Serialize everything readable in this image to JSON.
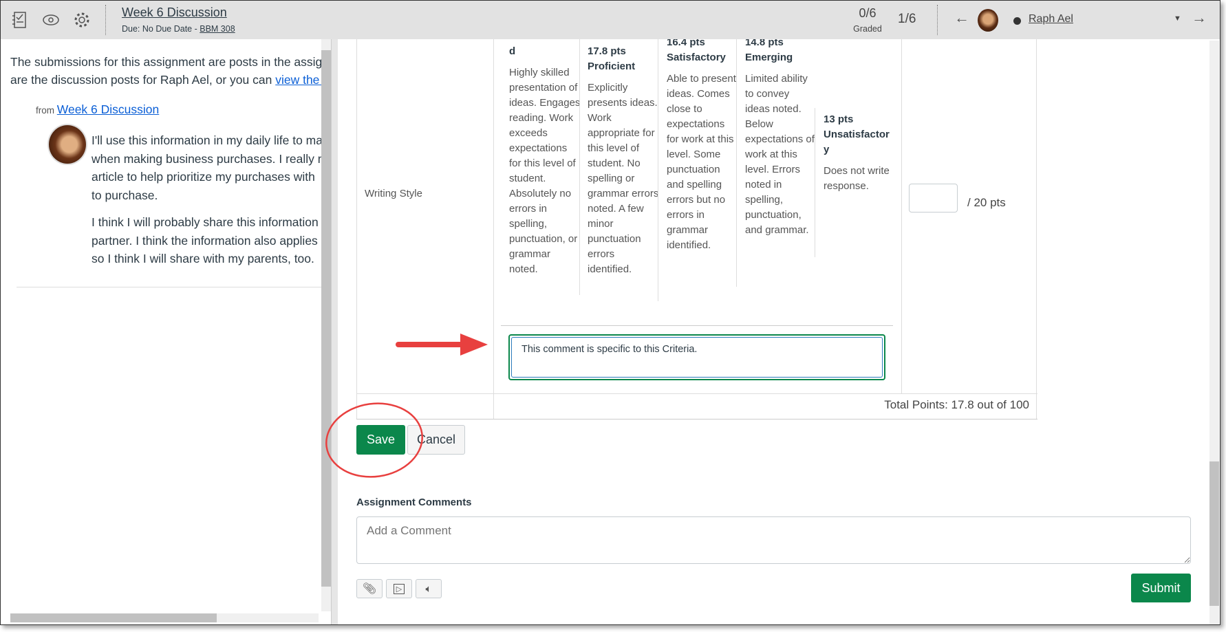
{
  "header": {
    "title": "Week 6 Discussion",
    "due": "Due: No Due Date - ",
    "course": "BBM 308",
    "graded_count": "0/6",
    "graded_label": "Graded",
    "position": "1/6",
    "student": "Raph Ael",
    "icons": [
      "grade-book-icon",
      "eye-icon",
      "gear-icon"
    ]
  },
  "left": {
    "intro_1": "The submissions for this assignment are posts in the assign",
    "intro_2": "are the discussion posts for Raph Ael, or you can ",
    "intro_link": "view the f",
    "from": "from ",
    "from_link": "Week 6 Discussion",
    "post_lines": [
      "I'll use this information in my daily life to ma",
      "when making business purchases. I really ne",
      "article to help prioritize my purchases with",
      "to purchase."
    ],
    "post_lines_2": [
      "I think I will probably share this information",
      "partner. I think the information also applies",
      "so I think I will share with my parents, too."
    ]
  },
  "rubric": {
    "criterion": "Writing Style",
    "ratings": [
      {
        "points": "",
        "label": "d",
        "desc": "Highly skilled presentation of ideas. Engages reading. Work exceeds expectations for this level of student. Absolutely no errors in spelling, punctuation, or grammar noted."
      },
      {
        "points": "17.8 pts",
        "label": "Proficient",
        "desc": "Explicitly presents ideas. Work appropriate for this level of student. No spelling or grammar errors noted. A few minor punctuation errors identified."
      },
      {
        "points": "16.4 pts",
        "label": "Satisfactory",
        "desc": "Able to present ideas. Comes close to expectations for work at this level. Some punctuation and spelling errors but no errors in grammar identified."
      },
      {
        "points": "14.8 pts",
        "label": "Emerging",
        "desc": "Limited ability to convey ideas noted. Below expectations of work at this level. Errors noted in spelling, punctuation, and grammar."
      },
      {
        "points": "13 pts",
        "label": "Unsatisfactory",
        "desc": "Does not write response."
      }
    ],
    "points_value": "",
    "points_suffix": "/ 20 pts",
    "comment": "This comment is specific to this Criteria.",
    "total": "Total Points: 17.8 out of 100"
  },
  "actions": {
    "save": "Save",
    "cancel": "Cancel"
  },
  "comments": {
    "label": "Assignment Comments",
    "placeholder": "Add a Comment",
    "submit": "Submit",
    "tools": [
      "attachment-icon",
      "media-icon",
      "audio-icon"
    ]
  },
  "colors": {
    "green": "#0b874b",
    "annotation": "#e8403f",
    "header_bg": "#e2e2e2"
  }
}
